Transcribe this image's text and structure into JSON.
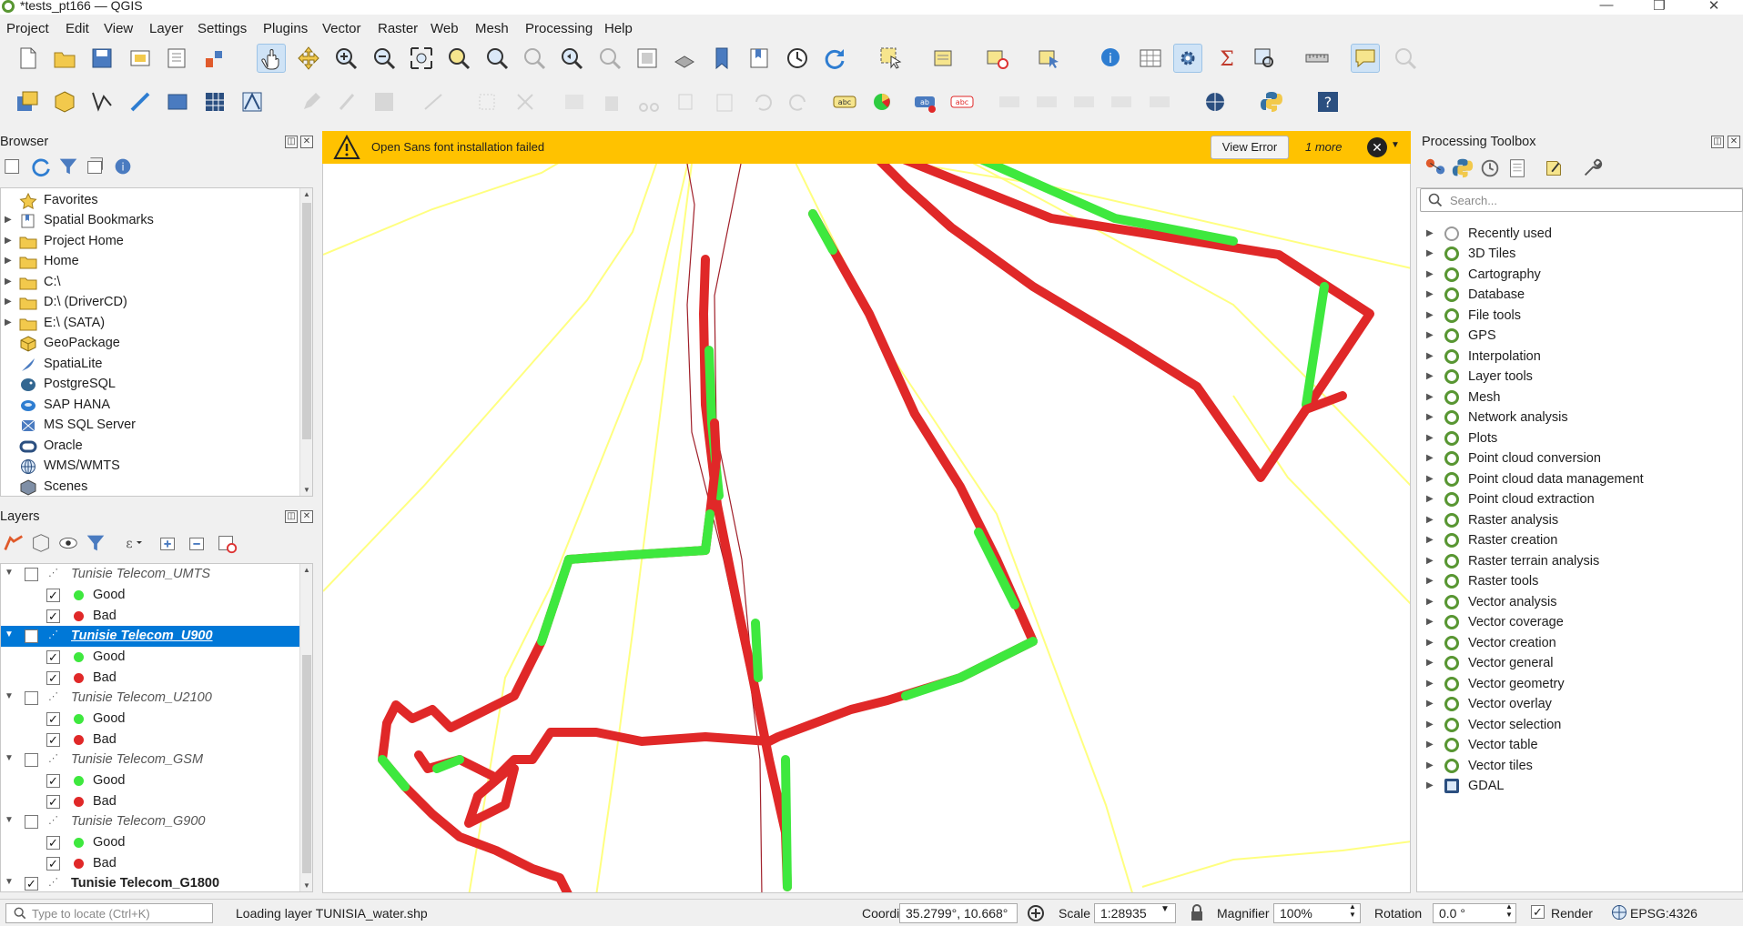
{
  "window": {
    "title": "*tests_pt166 — QGIS",
    "min": "—",
    "restore": "❐",
    "close": "✕"
  },
  "menu": [
    "Project",
    "Edit",
    "View",
    "Layer",
    "Settings",
    "Plugins",
    "Vector",
    "Raster",
    "Web",
    "Mesh",
    "Processing",
    "Help"
  ],
  "browser": {
    "title": "Browser",
    "items": [
      "Favorites",
      "Spatial Bookmarks",
      "Project Home",
      "Home",
      "C:\\",
      "D:\\ (DriverCD)",
      "E:\\ (SATA)",
      "GeoPackage",
      "SpatiaLite",
      "PostgreSQL",
      "SAP HANA",
      "MS SQL Server",
      "Oracle",
      "WMS/WMTS",
      "Scenes"
    ]
  },
  "layers": {
    "title": "Layers",
    "groups": [
      {
        "name": "Tunisie Telecom_UMTS",
        "good": "Good",
        "bad": "Bad"
      },
      {
        "name": "Tunisie Telecom_U900",
        "good": "Good",
        "bad": "Bad"
      },
      {
        "name": "Tunisie Telecom_U2100",
        "good": "Good",
        "bad": "Bad"
      },
      {
        "name": "Tunisie Telecom_GSM",
        "good": "Good",
        "bad": "Bad"
      },
      {
        "name": "Tunisie Telecom_G900",
        "good": "Good",
        "bad": "Bad"
      }
    ],
    "last": "Tunisie Telecom_G1800",
    "check": "✓"
  },
  "message": {
    "text": "Open Sans font installation failed",
    "button": "View Error",
    "more": "1 more",
    "close": "✕"
  },
  "toolbox": {
    "title": "Processing Toolbox",
    "search_placeholder": "Search...",
    "items": [
      "Recently used",
      "3D Tiles",
      "Cartography",
      "Database",
      "File tools",
      "GPS",
      "Interpolation",
      "Layer tools",
      "Mesh",
      "Network analysis",
      "Plots",
      "Point cloud conversion",
      "Point cloud data management",
      "Point cloud extraction",
      "Raster analysis",
      "Raster creation",
      "Raster terrain analysis",
      "Raster tools",
      "Vector analysis",
      "Vector coverage",
      "Vector creation",
      "Vector general",
      "Vector geometry",
      "Vector overlay",
      "Vector selection",
      "Vector table",
      "Vector tiles",
      "GDAL"
    ]
  },
  "status": {
    "locate_placeholder": "Type to locate (Ctrl+K)",
    "message": "Loading layer TUNISIA_water.shp",
    "coordinate_label": "Coordinate",
    "coordinate": "35.2799°, 10.668°",
    "scale_label": "Scale",
    "scale": "1:28935",
    "magnifier_label": "Magnifier",
    "magnifier": "100%",
    "rotation_label": "Rotation",
    "rotation": "0.0 °",
    "render_label": "Render",
    "crs": "EPSG:4326"
  },
  "colors": {
    "good": "#3ee83e",
    "bad": "#e02828",
    "selection": "#0078d7",
    "message_bar": "#ffc200",
    "road": "#ffff80"
  }
}
